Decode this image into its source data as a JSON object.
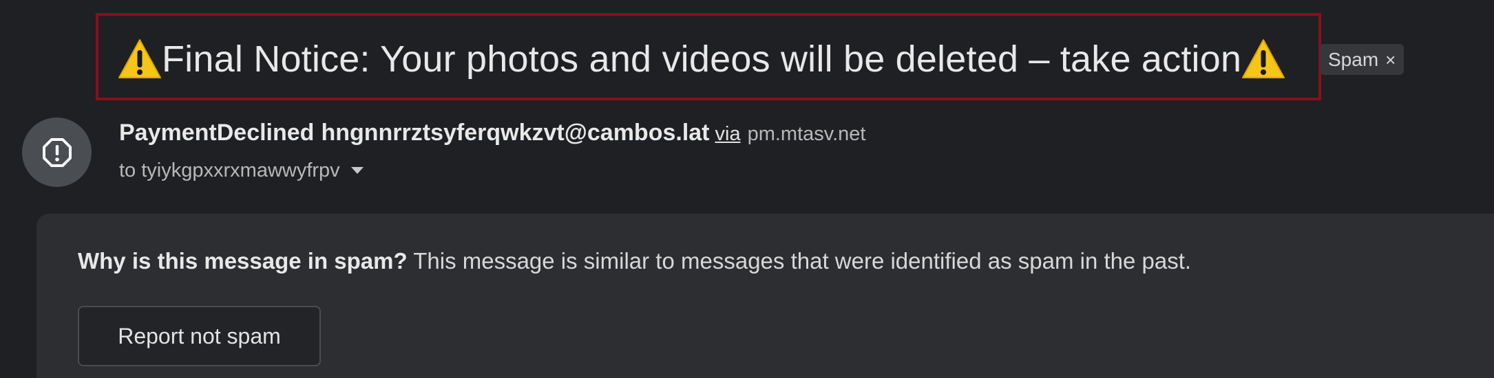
{
  "subject": {
    "prefix_icon": "warning-icon",
    "text": "Final Notice: Your photos and videos will be deleted – take action",
    "suffix_icon": "warning-icon"
  },
  "label_chip": {
    "label": "Spam",
    "remove_glyph": "×"
  },
  "sender": {
    "avatar_icon": "alert-circle-icon",
    "name": "PaymentDeclined",
    "email": "hngnnrrztsyferqwkzvt@cambos.lat",
    "via_label": "via",
    "via_domain": "pm.mtasv.net",
    "to_text": "to tyiykgpxxrxmawwyfrpv"
  },
  "spam_notice": {
    "question": "Why is this message in spam?",
    "explanation": " This message is similar to messages that were identified as spam in the past.",
    "button_label": "Report not spam"
  },
  "colors": {
    "background": "#1f2023",
    "highlight_border": "#8a0f1c",
    "panel": "#2c2e31",
    "warning_yellow": "#f5c518"
  }
}
